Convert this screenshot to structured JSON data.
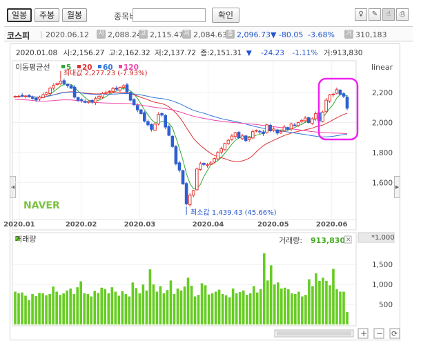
{
  "toolbar": {
    "tabs": [
      "일봉",
      "주봉",
      "월봉"
    ],
    "compare_label": "종목비교",
    "compare_value": "",
    "confirm_label": "확인"
  },
  "quote": {
    "name": "코스피",
    "date": "2020.06.12",
    "open_label": "시",
    "open": "2,088.24",
    "high_label": "고",
    "high": "2,115.47",
    "low_label": "저",
    "low": "2,084.63",
    "close_label": "종",
    "close": "2,096.73",
    "change": "▼ -80.05",
    "change_pct": "-3.68%",
    "volume_label": "거",
    "volume": "310,183"
  },
  "hover": {
    "date": "2020.01.08",
    "open_label": "시:",
    "open": "2,156.27",
    "high_label": "고:",
    "high": "2,162.32",
    "low_label": "저:",
    "low": "2,137.72",
    "close_label": "종:",
    "close": "2,151.31",
    "arrow": "▼",
    "change": "-24.23",
    "change_pct": "-1.11%",
    "volume_label": "거:",
    "volume": "913,830"
  },
  "chart_data": {
    "type": "candlestick",
    "scale": "linear",
    "ma_label": "이동평균선",
    "ma_series": [
      {
        "name": "5",
        "color": "#33aa33"
      },
      {
        "name": "20",
        "color": "#dd3333"
      },
      {
        "name": "60",
        "color": "#3377dd"
      },
      {
        "name": "120",
        "color": "#ee44aa"
      }
    ],
    "y_ticks": [
      "2,200",
      "2,000",
      "1,800",
      "1,600"
    ],
    "ylim": [
      1380,
      2330
    ],
    "x_labels": [
      "2020.01",
      "2020.02",
      "2020.03",
      "2020.04",
      "2020.05",
      "2020.06"
    ],
    "max_annotation": "최대값 2,277.23 (-7.93%)",
    "min_annotation": "최소값 1,439.43 (45.66%)",
    "watermark": "NAVER",
    "up_color": "#e8352f",
    "down_color": "#2f5fd0",
    "closes": [
      2175,
      2176,
      2180,
      2178,
      2172,
      2162,
      2151,
      2170,
      2186,
      2200,
      2230,
      2248,
      2262,
      2277,
      2260,
      2246,
      2230,
      2170,
      2150,
      2148,
      2135,
      2142,
      2136,
      2160,
      2176,
      2195,
      2200,
      2210,
      2228,
      2223,
      2235,
      2246,
      2205,
      2150,
      2120,
      2085,
      2060,
      2010,
      1985,
      1955,
      1990,
      2055,
      2050,
      1970,
      1915,
      1840,
      1725,
      1682,
      1590,
      1457,
      1515,
      1545,
      1690,
      1725,
      1720,
      1720,
      1730,
      1760,
      1800,
      1825,
      1860,
      1882,
      1910,
      1932,
      1898,
      1911,
      1880,
      1900,
      1940,
      1948,
      1937,
      1926,
      1985,
      1945,
      1957,
      1930,
      1940,
      1970,
      1955,
      1990,
      1980,
      2000,
      2015,
      2030,
      2000,
      2025,
      2060,
      2010,
      2070,
      2150,
      2185,
      2190,
      2220,
      2190,
      2176,
      2096
    ],
    "volume": {
      "label": "거래량",
      "current_label": "거래량:",
      "current": "913,830",
      "unit": "*1,000",
      "y_ticks": [
        "1,500",
        "1,000",
        "500"
      ],
      "ylim": [
        0,
        1900
      ],
      "bar_color": "#66cc22",
      "values": [
        820,
        780,
        800,
        720,
        610,
        760,
        710,
        790,
        780,
        730,
        760,
        950,
        820,
        740,
        780,
        850,
        900,
        760,
        930,
        1080,
        780,
        760,
        700,
        840,
        790,
        920,
        880,
        780,
        930,
        820,
        720,
        830,
        760,
        700,
        1050,
        910,
        780,
        1000,
        850,
        1380,
        1000,
        820,
        960,
        780,
        860,
        1100,
        760,
        900,
        850,
        950,
        1170,
        970,
        700,
        740,
        1030,
        980,
        750,
        780,
        820,
        870,
        760,
        730,
        680,
        900,
        780,
        810,
        850,
        740,
        780,
        960,
        800,
        880,
        1780,
        1100,
        1480,
        1000,
        1050,
        900,
        920,
        880,
        780,
        760,
        820,
        700,
        740,
        1130,
        960,
        1280,
        1090,
        1170,
        1090,
        980,
        1390,
        880,
        820,
        820,
        310
      ]
    }
  }
}
